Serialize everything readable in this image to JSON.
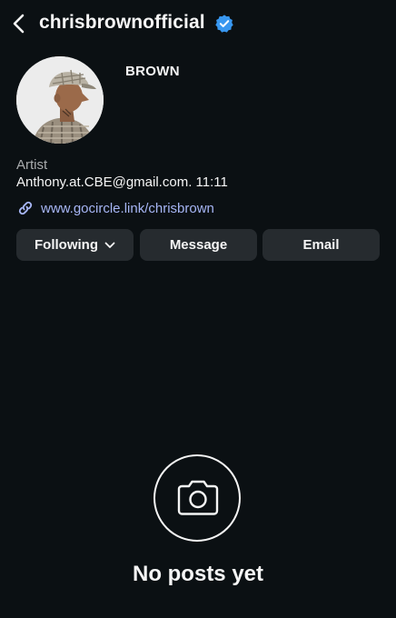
{
  "header": {
    "username": "chrisbrownofficial",
    "back_icon": "chevron-left-icon",
    "verified_icon": "verified-badge-icon",
    "verified_color": "#3897f0"
  },
  "profile": {
    "display_name": "BROWN",
    "category": "Artist",
    "bio": "Anthony.at.CBE@gmail.com. 11:11",
    "link": "www.gocircle.link/chrisbrown",
    "link_icon": "link-icon",
    "link_color": "#a6b5f4"
  },
  "actions": {
    "following": "Following",
    "message": "Message",
    "email": "Email"
  },
  "empty_state": {
    "icon": "camera-icon",
    "text": "No posts yet"
  }
}
